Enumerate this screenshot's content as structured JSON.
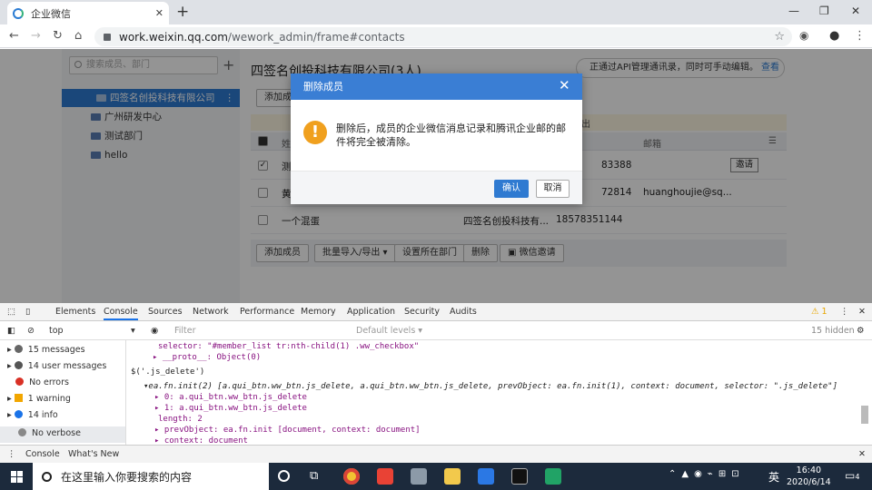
{
  "browser": {
    "tab_title": "企业微信",
    "url_host": "work.weixin.qq.com",
    "url_path": "/wework_admin/frame#contacts"
  },
  "sidebar": {
    "search_placeholder": "搜索成员、部门",
    "root": "四签名创投科技有限公司",
    "items": [
      {
        "label": "广州研发中心"
      },
      {
        "label": "测试部门"
      },
      {
        "label": "hello"
      }
    ]
  },
  "main": {
    "company_title": "四签名创投科技有限公司(3人)",
    "api_banner": "正通过API管理通讯录，同时可手动编辑。",
    "api_link": "查看",
    "top_button": "添加成",
    "notice_tail": "出",
    "headers": {
      "name": "姓",
      "email": "邮箱"
    },
    "rows": [
      {
        "name": "测",
        "dept": "",
        "phone": "83388",
        "email": "",
        "checked": true,
        "invite": "邀请"
      },
      {
        "name": "黄",
        "dept": "",
        "phone": "72814",
        "email": "huanghoujie@sq...",
        "checked": false,
        "invite": ""
      },
      {
        "name": "一个混蛋",
        "dept": "四签名创投科技有...",
        "phone": "18578351144",
        "email": "",
        "checked": false,
        "invite": ""
      }
    ],
    "bottom_buttons": {
      "add": "添加成员",
      "import": "批量导入/导出",
      "set_dept": "设置所在部门",
      "delete": "删除",
      "invite": "微信邀请"
    }
  },
  "dialog": {
    "title": "删除成员",
    "message": "删除后，成员的企业微信消息记录和腾讯企业邮的邮件将完全被清除。",
    "ok": "确认",
    "cancel": "取消"
  },
  "devtools": {
    "tabs": [
      "Elements",
      "Console",
      "Sources",
      "Network",
      "Performance",
      "Memory",
      "Application",
      "Security",
      "Audits"
    ],
    "warning_count": "1",
    "context": "top",
    "filter_placeholder": "Filter",
    "levels": "Default levels",
    "hidden": "15 hidden",
    "sidebar": [
      {
        "label": "15 messages",
        "color": "#555"
      },
      {
        "label": "14 user messages",
        "color": "#555"
      },
      {
        "label": "No errors",
        "color": "#d93025"
      },
      {
        "label": "1 warning",
        "color": "#f2a600"
      },
      {
        "label": "14 info",
        "color": "#1a73e8"
      },
      {
        "label": "No verbose",
        "color": "#888"
      }
    ],
    "console_lines": [
      "selector: \"#member_list tr:nth-child(1) .ww_checkbox\"",
      "▸ __proto__: Object(0)",
      "$('.js_delete')",
      "▾ea.fn.init(2) [a.qui_btn.ww_btn.js_delete, a.qui_btn.ww_btn.js_delete, prevObject: ea.fn.init(1), context: document, selector: \".js_delete\"]",
      "▸ 0: a.qui_btn.ww_btn.js_delete",
      "▸ 1: a.qui_btn.ww_btn.js_delete",
      "length: 2",
      "▸ prevObject: ea.fn.init [document, context: document]",
      "▸ context: document"
    ],
    "drawer_tabs": [
      "Console",
      "What's New"
    ]
  },
  "taskbar": {
    "search_placeholder": "在这里输入你要搜索的内容",
    "ime": "英",
    "time": "16:40",
    "date": "2020/6/14",
    "notif_count": "4"
  }
}
